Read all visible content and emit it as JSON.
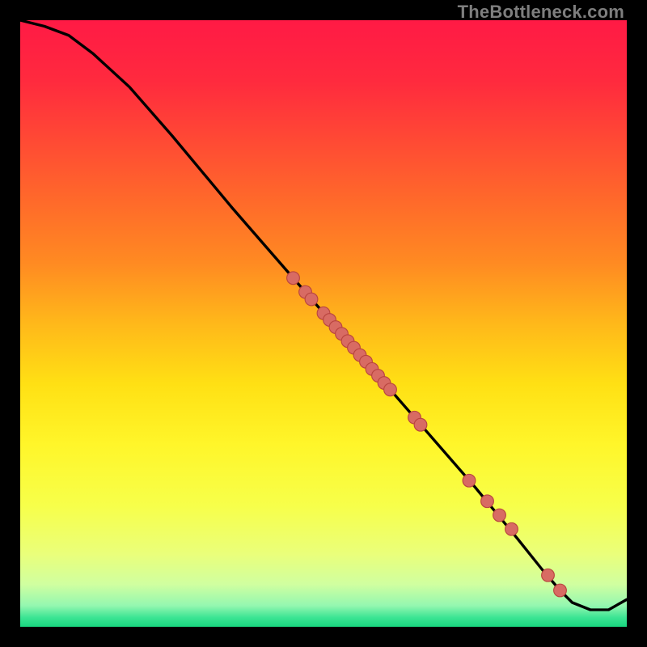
{
  "watermark": "TheBottleneck.com",
  "colors": {
    "bg": "#000000",
    "gradient_stops": [
      {
        "offset": 0.0,
        "color": "#ff1a45"
      },
      {
        "offset": 0.1,
        "color": "#ff2a3e"
      },
      {
        "offset": 0.2,
        "color": "#ff4a34"
      },
      {
        "offset": 0.3,
        "color": "#ff6a2a"
      },
      {
        "offset": 0.4,
        "color": "#ff8a22"
      },
      {
        "offset": 0.5,
        "color": "#ffb81a"
      },
      {
        "offset": 0.6,
        "color": "#ffe014"
      },
      {
        "offset": 0.7,
        "color": "#fff62a"
      },
      {
        "offset": 0.8,
        "color": "#f7ff4a"
      },
      {
        "offset": 0.88,
        "color": "#eaff7a"
      },
      {
        "offset": 0.93,
        "color": "#d0ffa0"
      },
      {
        "offset": 0.965,
        "color": "#94f7b0"
      },
      {
        "offset": 0.985,
        "color": "#3be493"
      },
      {
        "offset": 1.0,
        "color": "#18d67f"
      }
    ],
    "curve": "#000000",
    "marker_fill": "#d86b63",
    "marker_stroke": "#b9453f"
  },
  "chart_data": {
    "type": "line",
    "title": "",
    "xlabel": "",
    "ylabel": "",
    "xlim": [
      0,
      100
    ],
    "ylim": [
      0,
      100
    ],
    "series": [
      {
        "name": "curve",
        "x": [
          0,
          4,
          8,
          12,
          18,
          25,
          35,
          45,
          55,
          65,
          75,
          82,
          86,
          89,
          91,
          94,
          97,
          100
        ],
        "y": [
          100,
          99,
          97.5,
          94.5,
          89,
          81,
          69,
          57.5,
          46,
          34.5,
          23,
          14.5,
          9.5,
          6,
          4,
          2.8,
          2.8,
          4.5
        ]
      }
    ],
    "markers": {
      "name": "dots",
      "x": [
        45,
        47,
        48,
        50,
        51,
        52,
        53,
        54,
        55,
        56,
        57,
        58,
        59,
        60,
        61,
        65,
        66,
        74,
        77,
        79,
        81,
        87,
        89
      ],
      "y": [
        57.5,
        55.2,
        54.0,
        51.7,
        50.6,
        49.4,
        48.3,
        47.1,
        46.0,
        44.8,
        43.7,
        42.5,
        41.4,
        40.2,
        39.1,
        34.5,
        33.3,
        24.1,
        20.7,
        18.4,
        16.1,
        8.5,
        6.0
      ]
    }
  }
}
